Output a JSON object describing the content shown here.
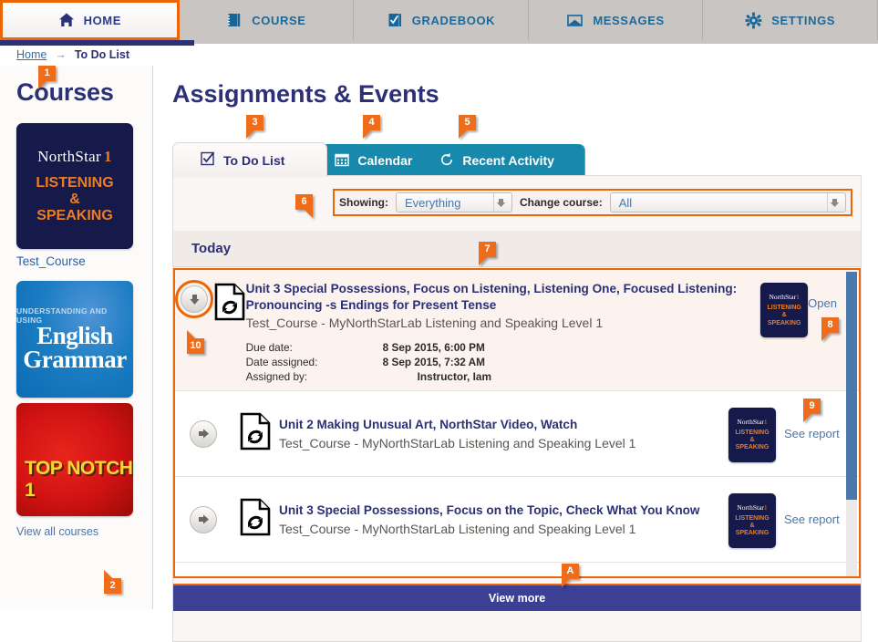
{
  "nav": {
    "tabs": [
      {
        "label": "HOME",
        "icon": "home-icon",
        "active": true
      },
      {
        "label": "COURSE",
        "icon": "book-icon",
        "active": false
      },
      {
        "label": "GRADEBOOK",
        "icon": "checkbook-icon",
        "active": false
      },
      {
        "label": "MESSAGES",
        "icon": "envelope-icon",
        "active": false
      },
      {
        "label": "SETTINGS",
        "icon": "gear-icon",
        "active": false
      }
    ]
  },
  "breadcrumb": {
    "home": "Home",
    "separator": "→",
    "current": "To Do List"
  },
  "sidebar": {
    "heading": "Courses",
    "books": [
      {
        "type": "northstar",
        "brand": "NorthStar",
        "level": "1",
        "subtitle_lines": [
          "LISTENING",
          "&",
          "SPEAKING"
        ],
        "course_name": "Test_Course"
      },
      {
        "type": "english-grammar",
        "top_line": "UNDERSTANDING AND USING",
        "main_lines": [
          "English",
          "Grammar"
        ]
      },
      {
        "type": "top-notch",
        "title": "TOP NOTCH 1"
      }
    ],
    "view_all": "View all courses"
  },
  "main": {
    "page_title": "Assignments & Events",
    "tabs": [
      {
        "label": "To Do List",
        "icon": "checkbox-icon",
        "active": true
      },
      {
        "label": "Calendar",
        "icon": "calendar-icon",
        "active": false
      },
      {
        "label": "Recent Activity",
        "icon": "refresh-icon",
        "active": false
      }
    ],
    "filters": {
      "showing_label": "Showing:",
      "showing_value": "Everything",
      "course_label": "Change course:",
      "course_value": "All"
    },
    "group_header": "Today",
    "rows": [
      {
        "title": "Unit 3 Special Possessions, Focus on Listening, Listening One, Focused Listening: Pronouncing -s Endings for Present Tense",
        "course": "Test_Course - MyNorthStarLab Listening and Speaking Level 1",
        "expanded": true,
        "arrow": "arrow-down-icon",
        "details": [
          {
            "key": "Due date:",
            "value": "8 Sep 2015, 6:00 PM",
            "indent": false
          },
          {
            "key": "Date assigned:",
            "value": "8 Sep 2015, 7:32 AM",
            "indent": false
          },
          {
            "key": "Assigned by:",
            "value": "Instructor, Iam",
            "indent": true
          }
        ],
        "thumb": {
          "brand": "NorthStar",
          "level": "1",
          "lines": [
            "LISTENING",
            "&",
            "SPEAKING"
          ]
        },
        "action": "Open"
      },
      {
        "title": "Unit 2 Making Unusual Art, NorthStar Video, Watch",
        "course": "Test_Course - MyNorthStarLab Listening and Speaking Level 1",
        "expanded": false,
        "arrow": "arrow-right-icon",
        "details": [],
        "thumb": {
          "brand": "NorthStar",
          "level": "1",
          "lines": [
            "LISTENING",
            "&",
            "SPEAKING"
          ]
        },
        "action": "See report"
      },
      {
        "title": "Unit 3 Special Possessions, Focus on the Topic, Check What You Know",
        "course": "Test_Course - MyNorthStarLab Listening and Speaking Level 1",
        "expanded": false,
        "arrow": "arrow-right-icon",
        "details": [],
        "thumb": {
          "brand": "NorthStar",
          "level": "1",
          "lines": [
            "LISTENING",
            "&",
            "SPEAKING"
          ]
        },
        "action": "See report"
      }
    ],
    "view_more": "View more"
  },
  "callouts": [
    {
      "id": "c1",
      "label": "1"
    },
    {
      "id": "c2",
      "label": "2"
    },
    {
      "id": "c3",
      "label": "3"
    },
    {
      "id": "c4",
      "label": "4"
    },
    {
      "id": "c5",
      "label": "5"
    },
    {
      "id": "c6",
      "label": "6"
    },
    {
      "id": "c7",
      "label": "7"
    },
    {
      "id": "c8",
      "label": "8"
    },
    {
      "id": "c9",
      "label": "9"
    },
    {
      "id": "c10",
      "label": "10"
    },
    {
      "id": "cA",
      "label": "A"
    }
  ],
  "colors": {
    "accent_orange": "#ec6608",
    "brand_navy": "#2b3077",
    "teal_tab": "#1789ad",
    "link_blue": "#4a76a8",
    "viewmore_blue": "#3b4095"
  }
}
